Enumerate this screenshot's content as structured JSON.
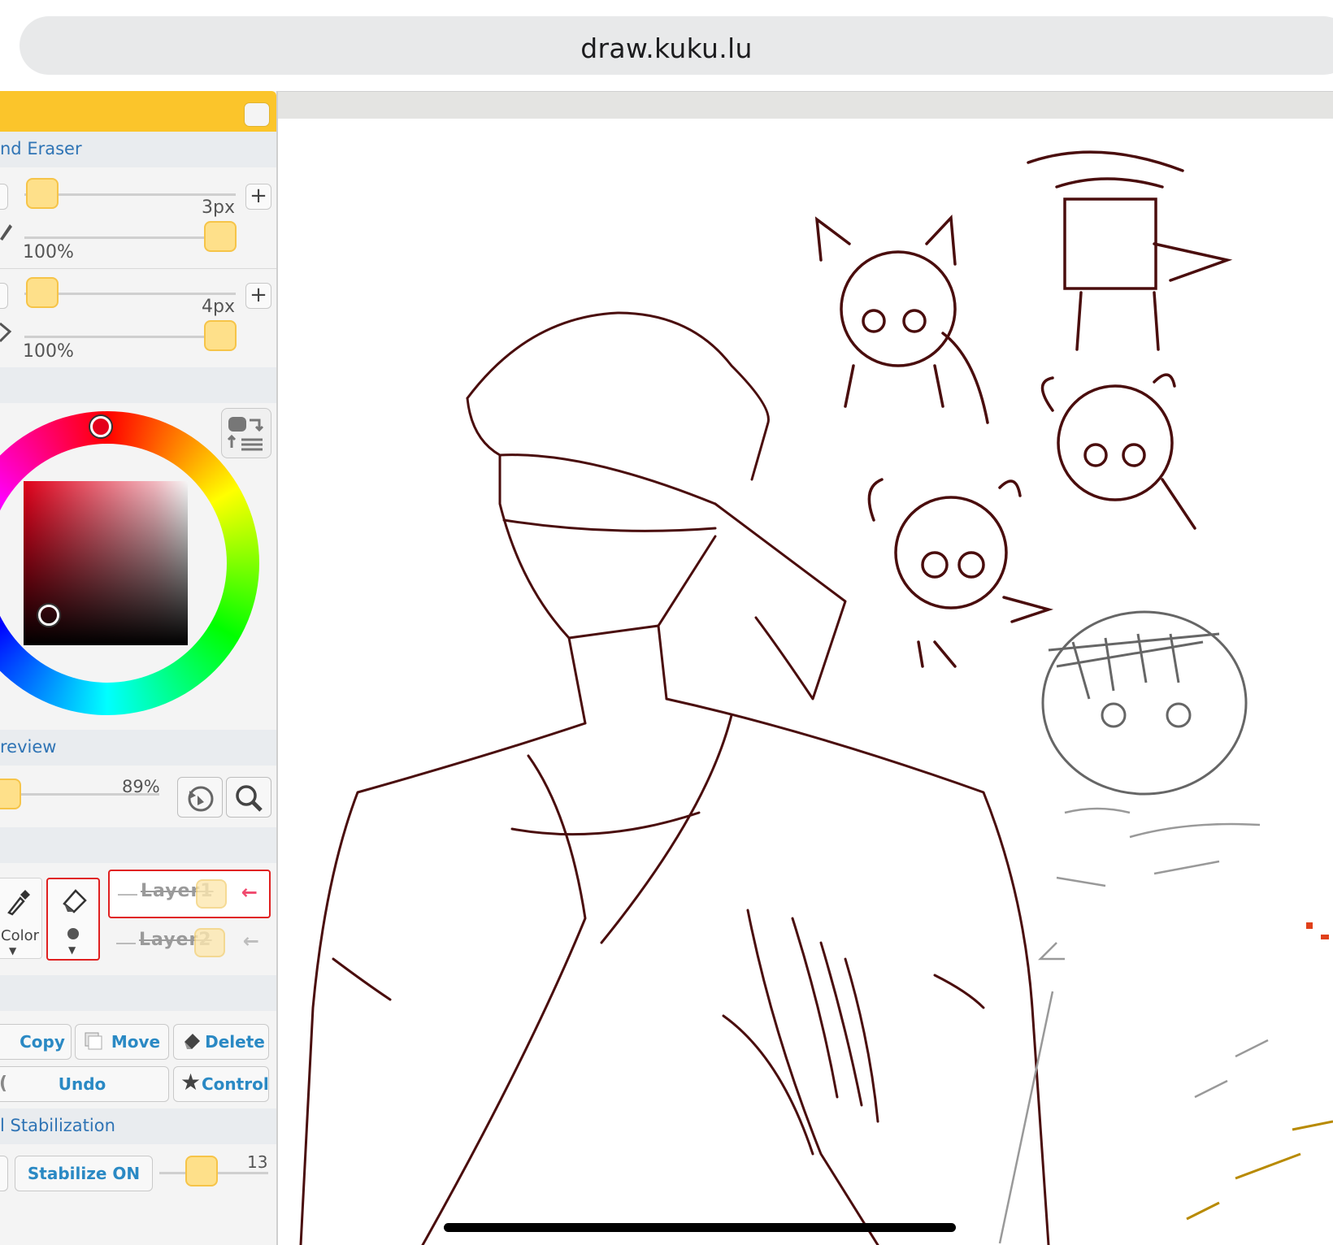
{
  "browser": {
    "url": "draw.kuku.lu"
  },
  "panel": {
    "pen_section_title": "nd Eraser",
    "pen": {
      "size_label": "3px",
      "opacity_label": "100%"
    },
    "eraser": {
      "size_label": "4px",
      "opacity_label": "100%"
    },
    "preview_title": "review",
    "zoom_label": "89%",
    "tools": {
      "color_label": "Color"
    },
    "layers": [
      {
        "name": "Layer1",
        "active": true
      },
      {
        "name": "Layer2",
        "active": false
      }
    ],
    "actions": {
      "copy": "Copy",
      "move": "Move",
      "delete": "Delete",
      "undo": "Undo",
      "control": "Control"
    },
    "stabilization_title": "l Stabilization",
    "stabilize_button": "Stabilize ON",
    "stabilize_value": "13"
  },
  "colors": {
    "accent": "#fbc52b",
    "link_blue": "#2f74b5",
    "active_red": "#e02020",
    "ink": "#5a0f0f"
  },
  "icons": [
    "plus-icon",
    "pencil-icon",
    "eraser-icon",
    "swap-colors-icon",
    "rotate-reset-icon",
    "magnifier-icon",
    "eyedropper-icon",
    "arrow-left-icon",
    "star-icon",
    "copy-icon",
    "move-icon",
    "delete-icon",
    "undo-icon"
  ]
}
